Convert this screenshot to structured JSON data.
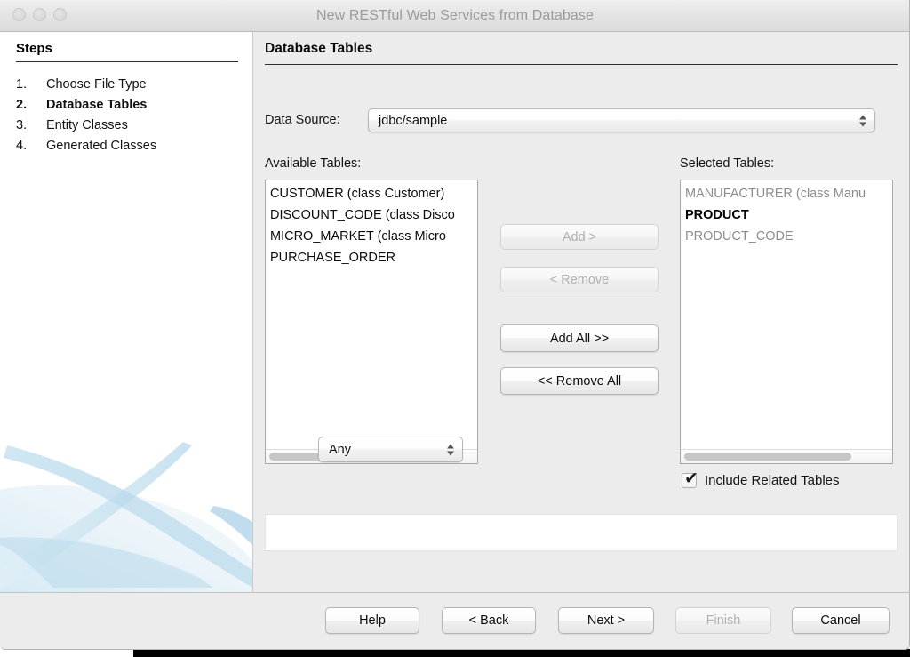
{
  "window": {
    "title": "New RESTful Web Services from Database",
    "traffic_lights": [
      "close",
      "minimize",
      "zoom"
    ]
  },
  "sidebar": {
    "heading": "Steps",
    "items": [
      {
        "num": "1.",
        "label": "Choose File Type",
        "current": false
      },
      {
        "num": "2.",
        "label": "Database Tables",
        "current": true
      },
      {
        "num": "3.",
        "label": "Entity Classes",
        "current": false
      },
      {
        "num": "4.",
        "label": "Generated Classes",
        "current": false
      }
    ]
  },
  "main": {
    "panel_title": "Database Tables",
    "data_source": {
      "label": "Data Source:",
      "value": "jdbc/sample"
    },
    "available": {
      "label": "Available Tables:",
      "items": [
        {
          "text": "CUSTOMER (class Customer)",
          "state": "normal"
        },
        {
          "text": "DISCOUNT_CODE (class Disco",
          "state": "normal"
        },
        {
          "text": "MICRO_MARKET (class Micro",
          "state": "normal"
        },
        {
          "text": "PURCHASE_ORDER",
          "state": "normal"
        }
      ],
      "scroll_thumb_pct": 74
    },
    "selected": {
      "label": "Selected Tables:",
      "items": [
        {
          "text": "MANUFACTURER (class Manu",
          "state": "dim"
        },
        {
          "text": "PRODUCT",
          "state": "strong"
        },
        {
          "text": "PRODUCT_CODE",
          "state": "dim"
        }
      ],
      "scroll_thumb_pct": 80
    },
    "transfer_buttons": [
      {
        "id": "add-button",
        "label": "Add >",
        "enabled": false
      },
      {
        "id": "remove-button",
        "label": "< Remove",
        "enabled": false
      },
      {
        "id": "add-all-button",
        "label": "Add All >>",
        "enabled": true
      },
      {
        "id": "remove-all-button",
        "label": "<< Remove All",
        "enabled": true
      }
    ],
    "filter": {
      "value": "Any"
    },
    "include_related": {
      "label": "Include Related Tables",
      "checked": true,
      "tick_glyph": "✔"
    },
    "info_message": ""
  },
  "footer": {
    "buttons": [
      {
        "id": "help-button",
        "label": "Help",
        "enabled": true
      },
      {
        "id": "back-button",
        "label": "< Back",
        "enabled": true
      },
      {
        "id": "next-button",
        "label": "Next >",
        "enabled": true
      },
      {
        "id": "finish-button",
        "label": "Finish",
        "enabled": false
      },
      {
        "id": "cancel-button",
        "label": "Cancel",
        "enabled": true
      }
    ]
  },
  "colors": {
    "window_bg": "#ececec",
    "sidebar_bg": "#ffffff",
    "title_text": "#9a9a9a",
    "accent_swoosh": "#bcd9ea",
    "disabled_text": "#b0b0b0",
    "list_dim_text": "#8d8d8d"
  }
}
